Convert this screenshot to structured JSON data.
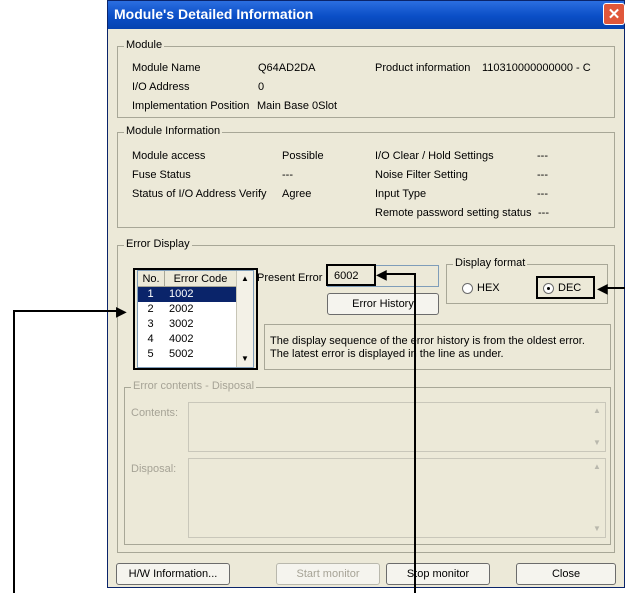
{
  "window": {
    "title": "Module's Detailed Information",
    "close_glyph": "✕"
  },
  "module": {
    "group_label": "Module",
    "name_label": "Module Name",
    "name_value": "Q64AD2DA",
    "product_label": "Product information",
    "product_value": "110310000000000 - C",
    "io_label": "I/O Address",
    "io_value": "0",
    "impl_label": "Implementation Position",
    "impl_value": "Main Base  0Slot"
  },
  "module_info": {
    "group_label": "Module Information",
    "access_label": "Module access",
    "access_value": "Possible",
    "fuse_label": "Fuse Status",
    "fuse_value": "---",
    "verify_label": "Status of I/O Address Verify",
    "verify_value": "Agree",
    "clear_label": "I/O Clear / Hold Settings",
    "clear_value": "---",
    "noise_label": "Noise Filter Setting",
    "noise_value": "---",
    "input_label": "Input Type",
    "input_value": "---",
    "remote_label": "Remote password setting status",
    "remote_value": "---"
  },
  "error_display": {
    "group_label": "Error Display",
    "col_no": "No.",
    "col_code": "Error Code",
    "rows": [
      {
        "no": "1",
        "code": "1002"
      },
      {
        "no": "2",
        "code": "2002"
      },
      {
        "no": "3",
        "code": "3002"
      },
      {
        "no": "4",
        "code": "4002"
      },
      {
        "no": "5",
        "code": "5002"
      }
    ],
    "present_error_label": "Present Error",
    "present_error_value": "6002",
    "history_button": "Error History",
    "display_format_label": "Display format",
    "hex_label": "HEX",
    "dec_label": "DEC",
    "selected_format": "DEC",
    "note_line1": "The display sequence of the error history is from the oldest error.",
    "note_line2": "The latest error is displayed in the line as under."
  },
  "error_contents": {
    "group_label": "Error contents - Disposal",
    "contents_label": "Contents:",
    "disposal_label": "Disposal:"
  },
  "buttons": {
    "hw_info": "H/W Information...",
    "start_monitor": "Start monitor",
    "stop_monitor": "Stop monitor",
    "close": "Close"
  }
}
